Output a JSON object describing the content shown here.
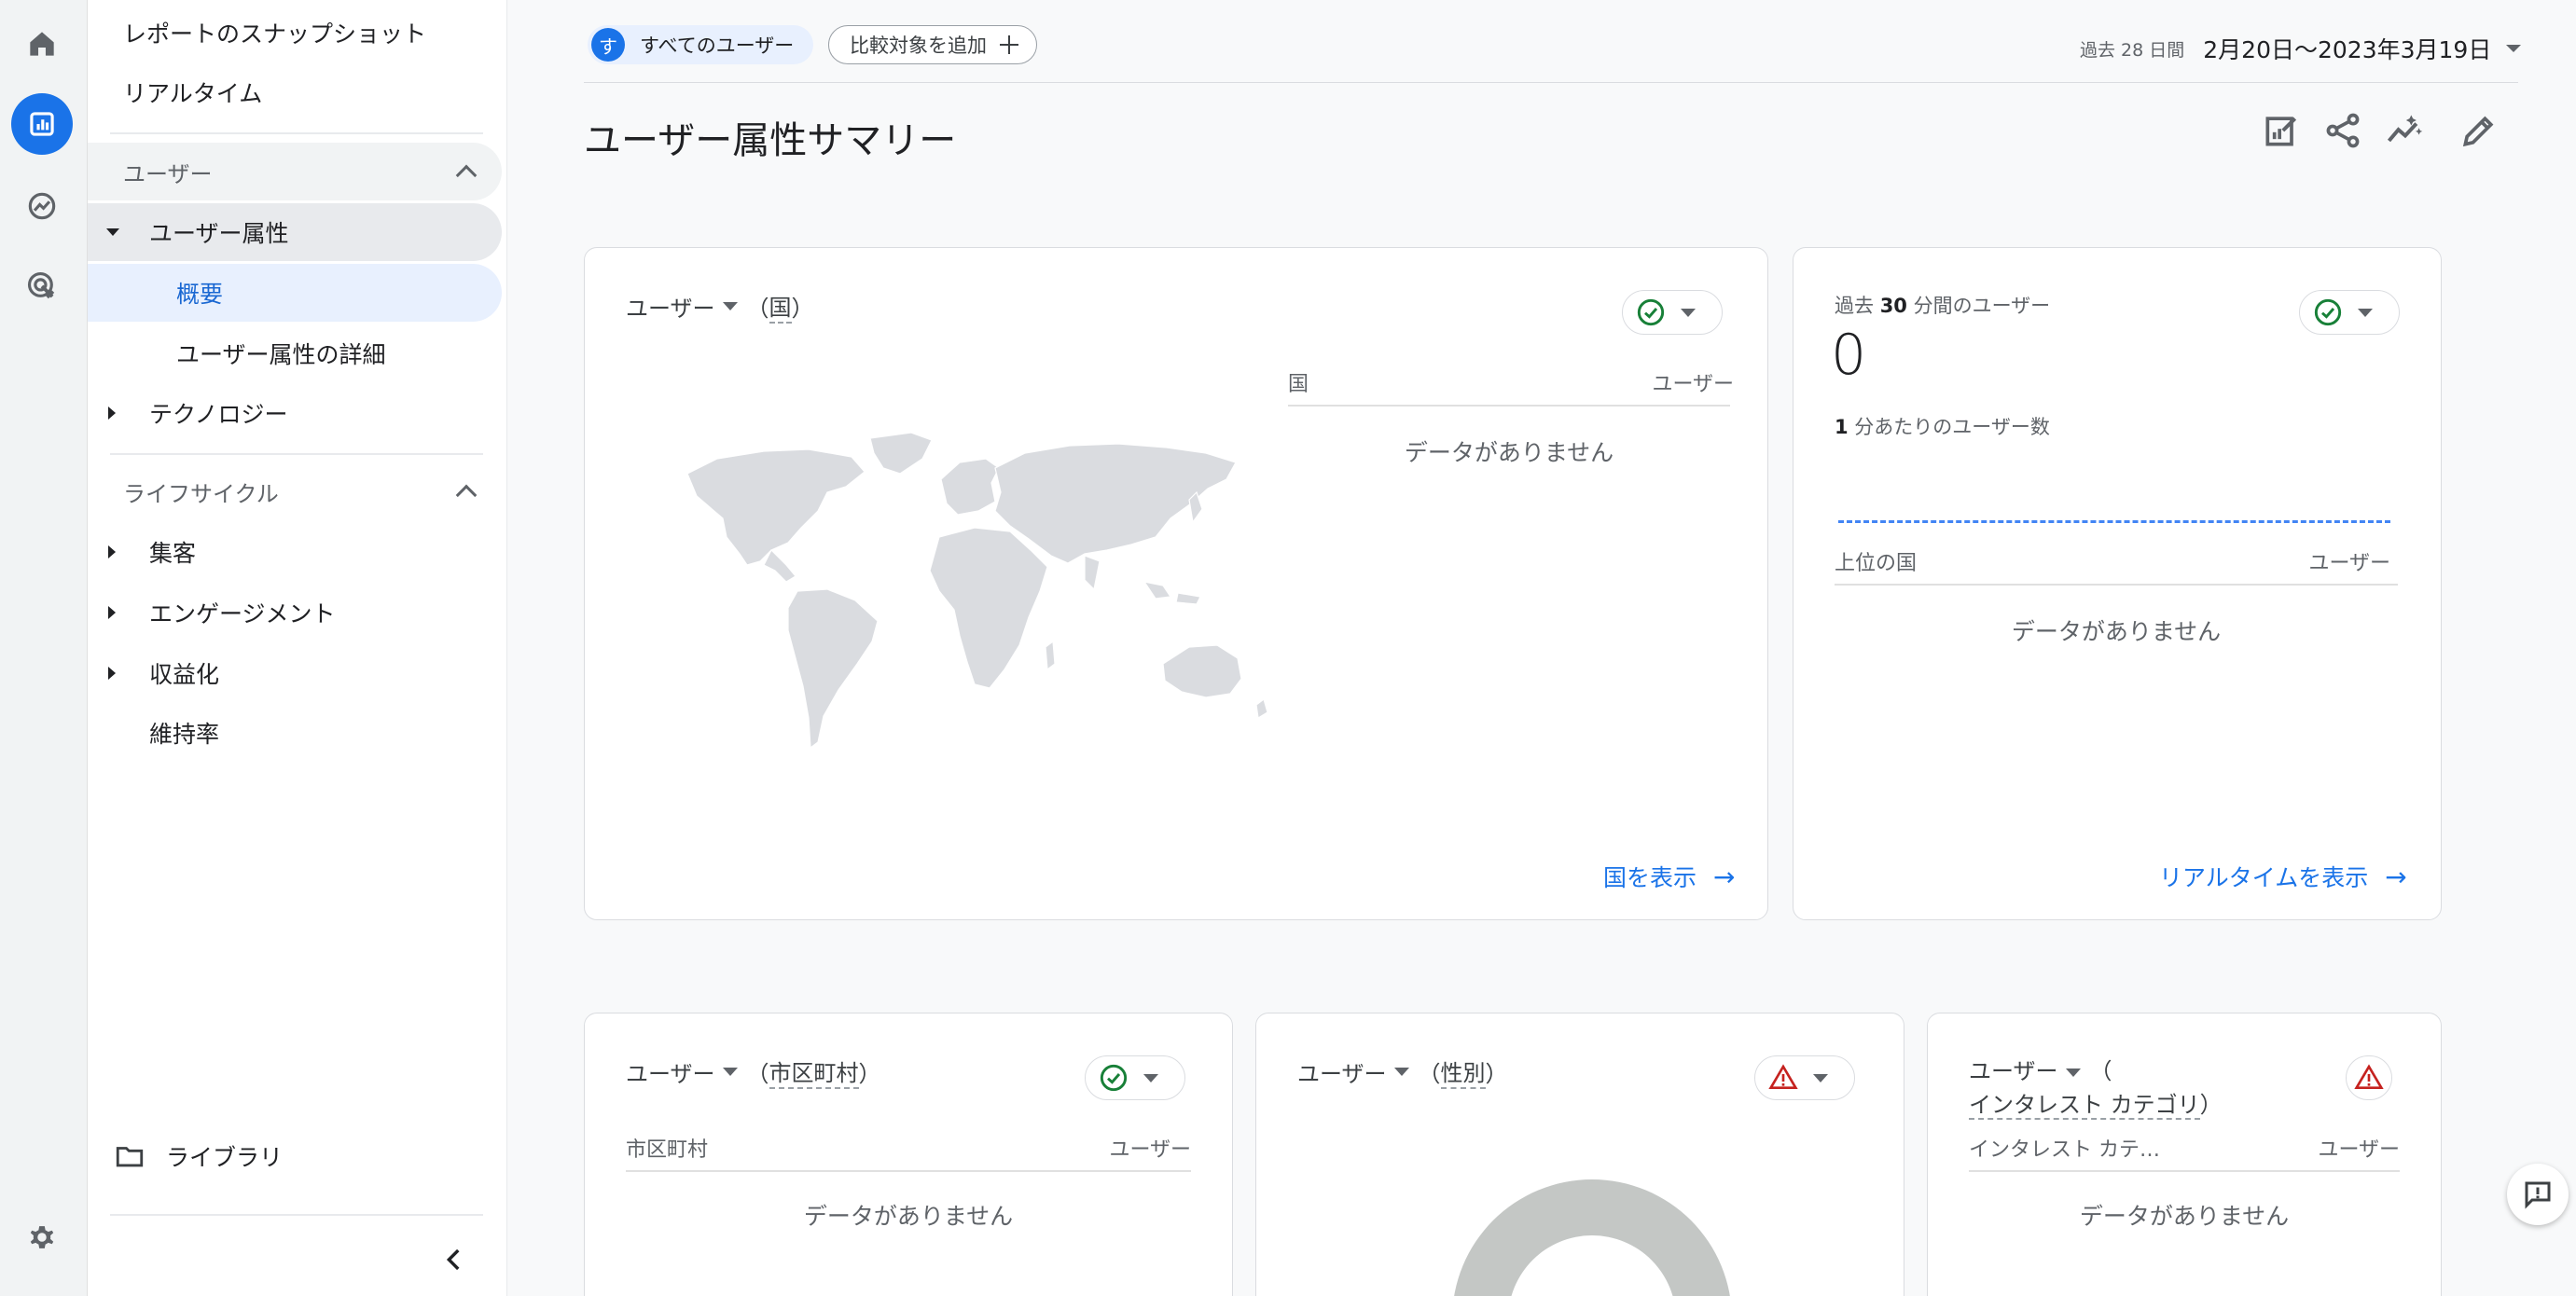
{
  "nav": {
    "snapshot": "レポートのスナップショット",
    "realtime": "リアルタイム",
    "section_user": "ユーザー",
    "user_attributes": "ユーザー属性",
    "overview": "概要",
    "attribute_details": "ユーザー属性の詳細",
    "technology": "テクノロジー",
    "section_lifecycle": "ライフサイクル",
    "acquisition": "集客",
    "engagement": "エンゲージメント",
    "monetization": "収益化",
    "retention": "維持率",
    "library": "ライブラリ"
  },
  "header": {
    "segment_avatar": "す",
    "segment_label": "すべてのユーザー",
    "compare_label": "比較対象を追加",
    "date_prefix": "過去 28 日間",
    "date_range": "2月20日〜2023年3月19日",
    "page_title": "ユーザー属性サマリー"
  },
  "cards": {
    "country": {
      "metric": "ユーザー",
      "dim_open": "（",
      "dimension": "国",
      "dim_close": "）",
      "col_left": "国",
      "col_right": "ユーザー",
      "empty": "データがありません",
      "link": "国を表示"
    },
    "realtime": {
      "label_prefix": "過去 ",
      "label_bold": "30",
      "label_suffix": " 分間のユーザー",
      "value": "0",
      "per_min_bold": "1",
      "per_min_suffix": " 分あたりのユーザー数",
      "col_left": "上位の国",
      "col_right": "ユーザー",
      "empty": "データがありません",
      "link": "リアルタイムを表示"
    },
    "city": {
      "metric": "ユーザー",
      "dim_open": "（",
      "dimension": "市区町村",
      "dim_close": "）",
      "col_left": "市区町村",
      "col_right": "ユーザー",
      "empty": "データがありません"
    },
    "gender": {
      "metric": "ユーザー",
      "dim_open": "（",
      "dimension": "性別",
      "dim_close": "）"
    },
    "interest": {
      "metric": "ユーザー",
      "dim_open": "（",
      "dimension": "インタレスト カテゴリ",
      "dim_close": "）",
      "col_left": "インタレスト カテ…",
      "col_right": "ユーザー",
      "empty": "データがありません"
    }
  },
  "colors": {
    "accent": "#1a73e8",
    "ok": "#188038",
    "warning": "#c5221f",
    "map_fill": "#dadce0"
  }
}
